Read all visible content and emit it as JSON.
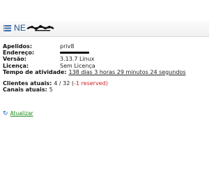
{
  "header": {
    "title": "NE",
    "icon": "server-list-icon"
  },
  "info": {
    "aliases_label": "Apelidos:",
    "aliases_value": "priv8",
    "address_label": "Endereço:",
    "version_label": "Versão:",
    "version_value": "3.13.7 Linux",
    "license_label": "Licença:",
    "license_value": "Sem Licença",
    "uptime_label": "Tempo de atividade:",
    "uptime_value": "138 dias 3 horas 29 minutos 24 segundos"
  },
  "stats": {
    "clients_label": "Clientes atuais:",
    "clients_value": "4 / 32 (",
    "clients_reserved": "-1 reserved",
    "clients_close": ")",
    "channels_label": "Canais atuais:",
    "channels_value": "5"
  },
  "actions": {
    "refresh_label": "Atualizar",
    "refresh_icon": "refresh-icon"
  },
  "colors": {
    "title": "#1d4f8f",
    "reserved": "#cc2020",
    "link": "#1a8a1a",
    "refresh_icon": "#1a62b8"
  }
}
